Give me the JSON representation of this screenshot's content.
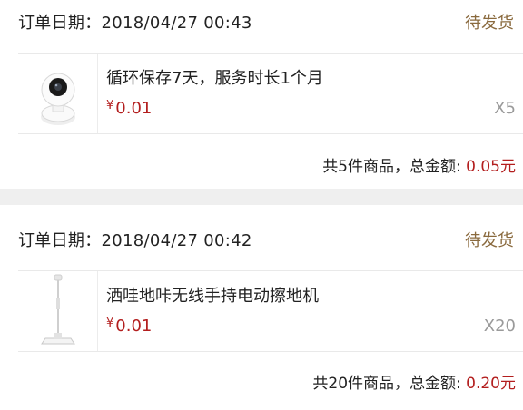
{
  "orders": [
    {
      "date_label": "订单日期：",
      "date": "2018/04/27 00:43",
      "status": "待发货",
      "product": {
        "thumbnail_icon": "security-camera-icon",
        "name": "循环保存7天，服务时长1个月",
        "currency": "¥",
        "price": "0.01",
        "qty": "X5"
      },
      "summary": {
        "count_text": "共5件商品，总金额: ",
        "total": "0.05元"
      }
    },
    {
      "date_label": "订单日期：",
      "date": "2018/04/27 00:42",
      "status": "待发货",
      "product": {
        "thumbnail_icon": "floor-mop-icon",
        "name": "洒哇地咔无线手持电动擦地机",
        "currency": "¥",
        "price": "0.01",
        "qty": "X20"
      },
      "summary": {
        "count_text": "共20件商品，总金额: ",
        "total": "0.20元"
      }
    }
  ],
  "colors": {
    "status": "#8a6a3e",
    "price": "#b31e1e",
    "background": "#efefef"
  }
}
